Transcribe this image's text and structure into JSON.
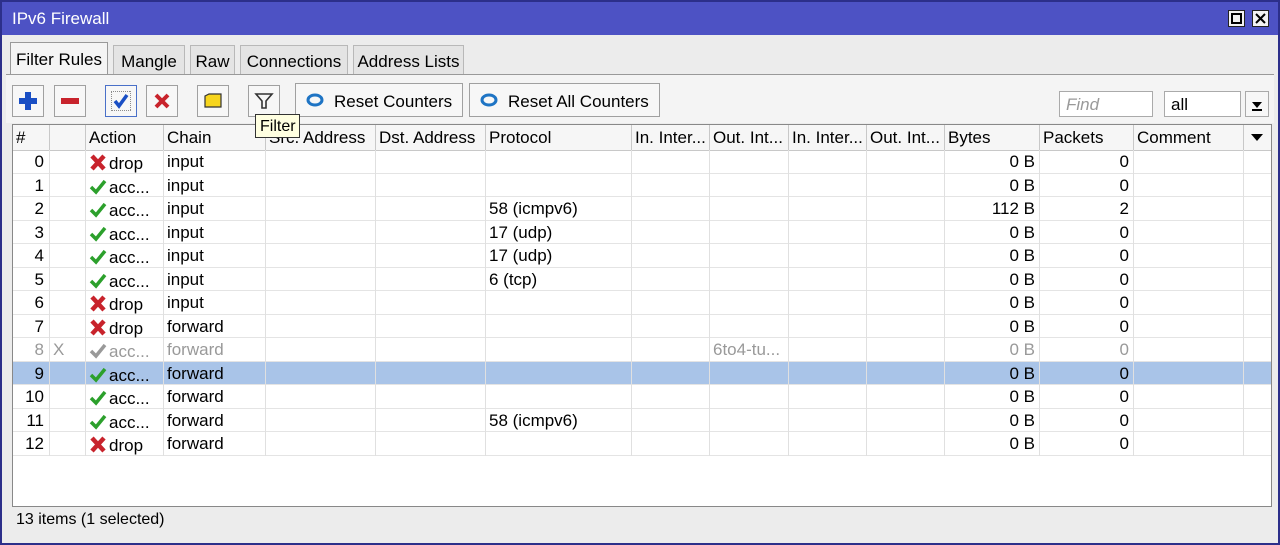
{
  "window": {
    "title": "IPv6 Firewall"
  },
  "tabs": [
    {
      "label": "Filter Rules",
      "active": true
    },
    {
      "label": "Mangle",
      "active": false
    },
    {
      "label": "Raw",
      "active": false
    },
    {
      "label": "Connections",
      "active": false
    },
    {
      "label": "Address Lists",
      "active": false
    }
  ],
  "toolbar": {
    "reset_counters": "Reset Counters",
    "reset_all_counters": "Reset All Counters",
    "find_placeholder": "Find",
    "filter_value": "all",
    "tooltip": "Filter",
    "icons": [
      "add-icon",
      "remove-icon",
      "enable-icon",
      "disable-icon",
      "comment-icon",
      "filter-icon"
    ]
  },
  "columns": [
    "#",
    "",
    "Action",
    "Chain",
    "Src. Address",
    "Dst. Address",
    "Protocol",
    "In. Inter...",
    "Out. Int...",
    "In. Inter...",
    "Out. Int...",
    "Bytes",
    "Packets",
    "Comment"
  ],
  "rows": [
    {
      "idx": "0",
      "flag": "",
      "action": "drop",
      "chain": "input",
      "protocol": "",
      "out_int": "",
      "bytes": "0 B",
      "packets": "0"
    },
    {
      "idx": "1",
      "flag": "",
      "action": "acc...",
      "chain": "input",
      "protocol": "",
      "out_int": "",
      "bytes": "0 B",
      "packets": "0"
    },
    {
      "idx": "2",
      "flag": "",
      "action": "acc...",
      "chain": "input",
      "protocol": "58 (icmpv6)",
      "out_int": "",
      "bytes": "112 B",
      "packets": "2"
    },
    {
      "idx": "3",
      "flag": "",
      "action": "acc...",
      "chain": "input",
      "protocol": "17 (udp)",
      "out_int": "",
      "bytes": "0 B",
      "packets": "0"
    },
    {
      "idx": "4",
      "flag": "",
      "action": "acc...",
      "chain": "input",
      "protocol": "17 (udp)",
      "out_int": "",
      "bytes": "0 B",
      "packets": "0"
    },
    {
      "idx": "5",
      "flag": "",
      "action": "acc...",
      "chain": "input",
      "protocol": "6 (tcp)",
      "out_int": "",
      "bytes": "0 B",
      "packets": "0"
    },
    {
      "idx": "6",
      "flag": "",
      "action": "drop",
      "chain": "input",
      "protocol": "",
      "out_int": "",
      "bytes": "0 B",
      "packets": "0"
    },
    {
      "idx": "7",
      "flag": "",
      "action": "drop",
      "chain": "forward",
      "protocol": "",
      "out_int": "",
      "bytes": "0 B",
      "packets": "0"
    },
    {
      "idx": "8",
      "flag": "X",
      "action": "acc...",
      "chain": "forward",
      "protocol": "",
      "out_int": "6to4-tu...",
      "bytes": "0 B",
      "packets": "0"
    },
    {
      "idx": "9",
      "flag": "",
      "action": "acc...",
      "chain": "forward",
      "protocol": "",
      "out_int": "",
      "bytes": "0 B",
      "packets": "0"
    },
    {
      "idx": "10",
      "flag": "",
      "action": "acc...",
      "chain": "forward",
      "protocol": "",
      "out_int": "",
      "bytes": "0 B",
      "packets": "0"
    },
    {
      "idx": "11",
      "flag": "",
      "action": "acc...",
      "chain": "forward",
      "protocol": "58 (icmpv6)",
      "out_int": "",
      "bytes": "0 B",
      "packets": "0"
    },
    {
      "idx": "12",
      "flag": "",
      "action": "drop",
      "chain": "forward",
      "protocol": "",
      "out_int": "",
      "bytes": "0 B",
      "packets": "0"
    }
  ],
  "selected_row": "9",
  "status": {
    "text": "13 items (1 selected)"
  },
  "colors": {
    "titlebar": "#4d52c4",
    "selection": "#a9c4e8",
    "accept": "#2ca02c",
    "drop": "#c8232c",
    "disabled": "#999999"
  }
}
